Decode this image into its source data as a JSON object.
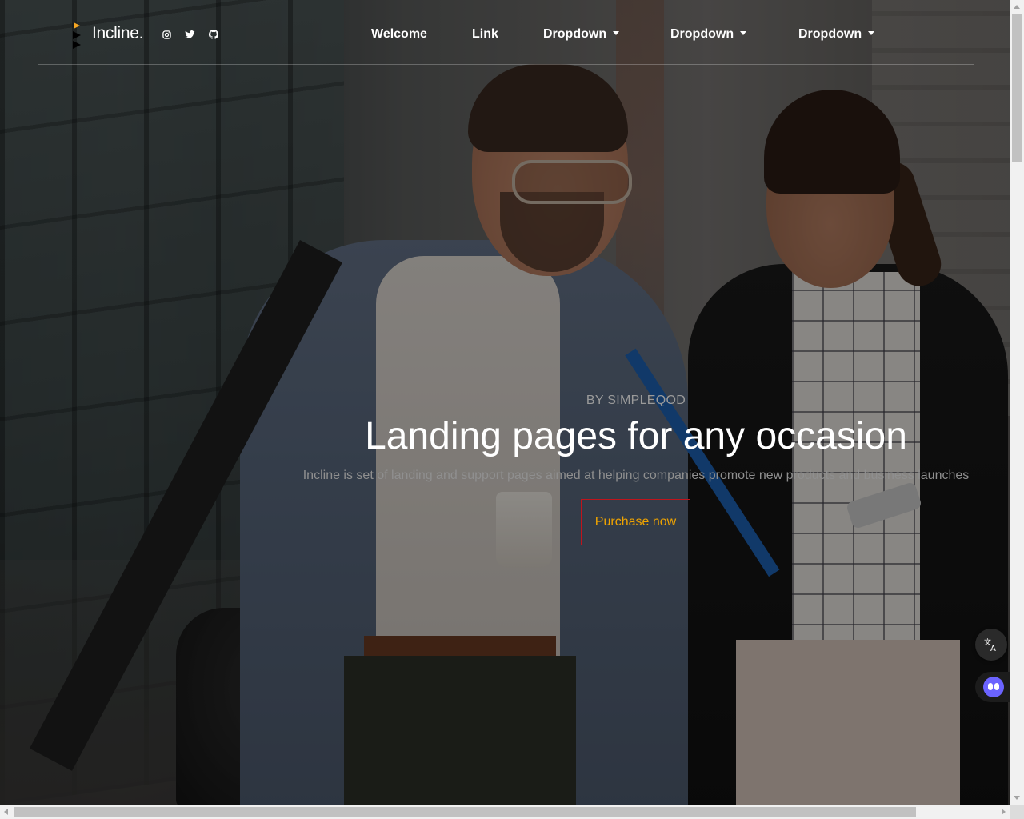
{
  "brand": {
    "name": "Incline.",
    "accent_color": "#f5a623"
  },
  "social_icons": [
    "instagram-icon",
    "twitter-icon",
    "github-icon"
  ],
  "nav": {
    "items": [
      {
        "label": "Welcome",
        "dropdown": false
      },
      {
        "label": "Link",
        "dropdown": false
      },
      {
        "label": "Dropdown",
        "dropdown": true
      },
      {
        "label": "Dropdown",
        "dropdown": true
      },
      {
        "label": "Dropdown",
        "dropdown": true
      }
    ]
  },
  "hero": {
    "eyebrow": "BY SIMPLEQOD",
    "headline": "Landing pages for any occasion",
    "subhead": "Incline is set of landing and support pages aimed at helping companies promote new products and business launches",
    "cta_label": "Purchase now",
    "cta_border_color": "#c0141c",
    "cta_text_color": "#f0a400"
  },
  "widgets": [
    "translate-icon",
    "assistant-bot-icon"
  ]
}
